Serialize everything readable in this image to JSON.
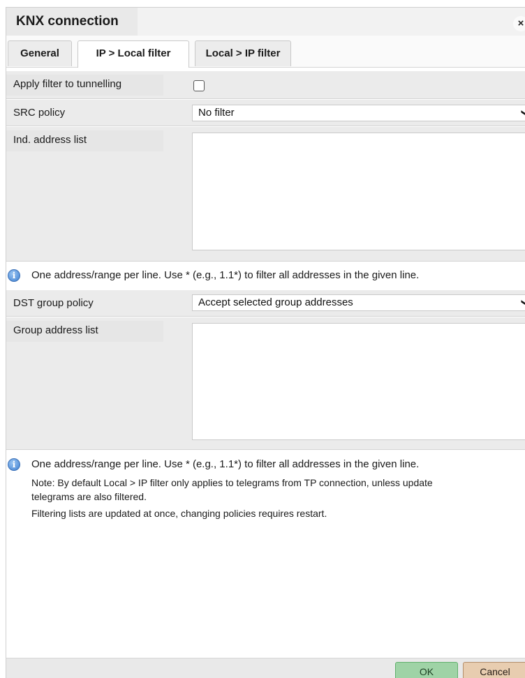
{
  "window": {
    "title": "KNX connection",
    "close_glyph": "×"
  },
  "tabs": [
    {
      "label": "General",
      "active": false
    },
    {
      "label": "IP > Local filter",
      "active": true
    },
    {
      "label": "Local > IP filter",
      "active": false
    }
  ],
  "form": {
    "apply_filter": {
      "label": "Apply filter to tunnelling",
      "checked": false
    },
    "src_policy": {
      "label": "SRC policy",
      "value": "No filter"
    },
    "ind_address_list": {
      "label": "Ind. address list",
      "value": ""
    },
    "ind_hint": "One address/range per line. Use * (e.g., 1.1*) to filter all addresses in the given line.",
    "dst_policy": {
      "label": "DST group policy",
      "value": "Accept selected group addresses"
    },
    "group_address_list": {
      "label": "Group address list",
      "value": ""
    },
    "group_hint": "One address/range per line. Use * (e.g., 1.1*) to filter all addresses in the given line.",
    "notes": [
      "Note: By default Local > IP filter only applies to telegrams from TP connection, unless update",
      "telegrams are also filtered.",
      "Filtering lists are updated at once, changing policies requires restart."
    ]
  },
  "icons": {
    "info": "info-icon",
    "chevron": "chevron-down-icon",
    "close": "close-icon"
  },
  "footer": {
    "ok_label": "OK",
    "cancel_label": "Cancel"
  },
  "colors": {
    "ok_bg": "#9fd3a6",
    "cancel_bg": "#e8cdb0",
    "info_icon": "#3d7fd1"
  }
}
